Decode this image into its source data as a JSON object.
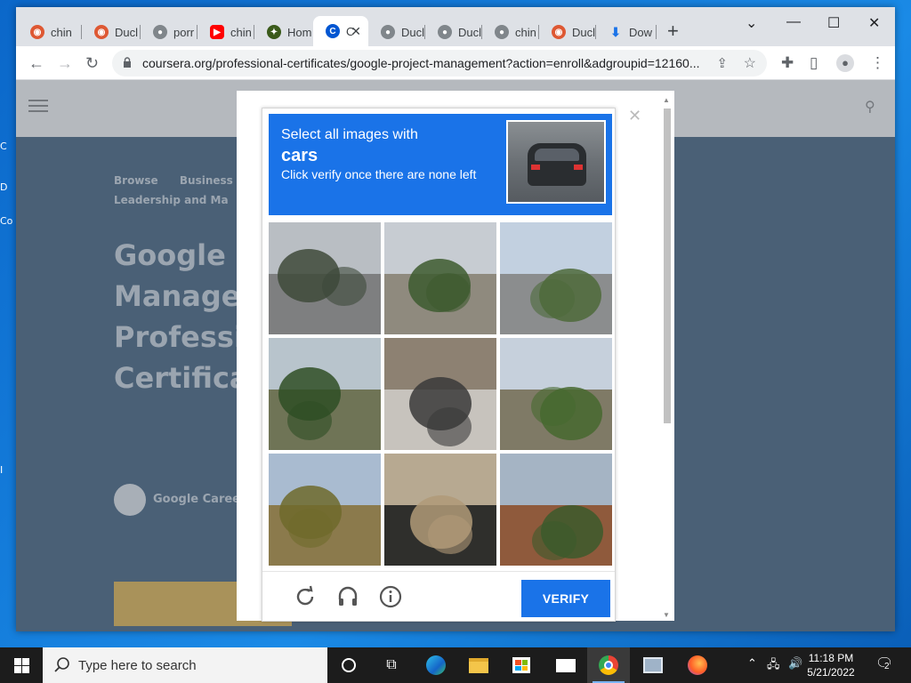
{
  "browser": {
    "tabs": [
      {
        "label": "chin",
        "icon": "duckduckgo-icon"
      },
      {
        "label": "Ducl",
        "icon": "duckduckgo-icon"
      },
      {
        "label": "porr",
        "icon": "globe-icon"
      },
      {
        "label": "chin",
        "icon": "youtube-icon"
      },
      {
        "label": "Hom",
        "icon": "site-icon"
      },
      {
        "label": "C",
        "icon": "coursera-icon",
        "active": true
      },
      {
        "label": "Ducl",
        "icon": "globe-icon"
      },
      {
        "label": "Ducl",
        "icon": "globe-icon"
      },
      {
        "label": "chin",
        "icon": "globe-icon"
      },
      {
        "label": "Ducl",
        "icon": "duckduckgo-icon"
      },
      {
        "label": "Dow",
        "icon": "download-icon"
      }
    ],
    "url": "coursera.org/professional-certificates/google-project-management?action=enroll&adgroupid=12160..."
  },
  "page": {
    "breadcrumb_1": "Browse",
    "breadcrumb_2": "Business",
    "breadcrumb_3": "Leadership and Ma",
    "title_lines": [
      "Google P",
      "Manage",
      "Professi",
      "Certifica"
    ],
    "provider": "Google Caree"
  },
  "captcha": {
    "instruction": "Select all images with",
    "target": "cars",
    "hint": "Click verify once there are none left",
    "verify_label": "VERIFY",
    "tiles": [
      {
        "sky": "#b9bec3",
        "ground": "#7e7f80",
        "accent": "#3e4a3a"
      },
      {
        "sky": "#c7ccd2",
        "ground": "#8f8a7e",
        "accent": "#3d5a2f"
      },
      {
        "sky": "#c2d0e0",
        "ground": "#8b8d8e",
        "accent": "#4d6a3a"
      },
      {
        "sky": "#b8c4cc",
        "ground": "#6f7456",
        "accent": "#2f4f24"
      },
      {
        "sky": "#8d8172",
        "ground": "#c7c3bd",
        "accent": "#3a3a3a"
      },
      {
        "sky": "#c6d0dc",
        "ground": "#7f7a66",
        "accent": "#46692f"
      },
      {
        "sky": "#a9bbd0",
        "ground": "#8b7a4c",
        "accent": "#6f6a2c"
      },
      {
        "sky": "#b7a991",
        "ground": "#2f2f2c",
        "accent": "#b09a78"
      },
      {
        "sky": "#a5b4c4",
        "ground": "#8f5a3c",
        "accent": "#3c5a2c"
      }
    ]
  },
  "taskbar": {
    "search_placeholder": "Type here to search",
    "time": "11:18 PM",
    "date": "5/21/2022",
    "notification_count": "2"
  }
}
